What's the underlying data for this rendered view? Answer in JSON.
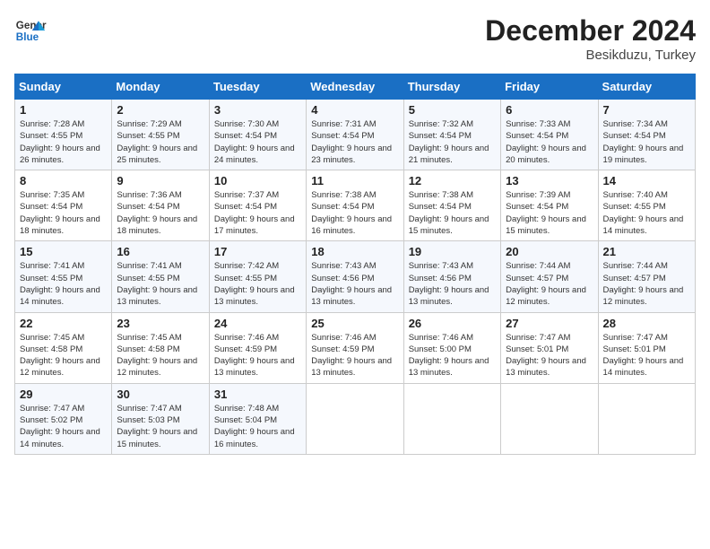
{
  "header": {
    "logo_line1": "General",
    "logo_line2": "Blue",
    "month_year": "December 2024",
    "location": "Besikduzu, Turkey"
  },
  "weekdays": [
    "Sunday",
    "Monday",
    "Tuesday",
    "Wednesday",
    "Thursday",
    "Friday",
    "Saturday"
  ],
  "weeks": [
    [
      {
        "day": "1",
        "sunrise": "7:28 AM",
        "sunset": "4:55 PM",
        "daylight": "9 hours and 26 minutes."
      },
      {
        "day": "2",
        "sunrise": "7:29 AM",
        "sunset": "4:55 PM",
        "daylight": "9 hours and 25 minutes."
      },
      {
        "day": "3",
        "sunrise": "7:30 AM",
        "sunset": "4:54 PM",
        "daylight": "9 hours and 24 minutes."
      },
      {
        "day": "4",
        "sunrise": "7:31 AM",
        "sunset": "4:54 PM",
        "daylight": "9 hours and 23 minutes."
      },
      {
        "day": "5",
        "sunrise": "7:32 AM",
        "sunset": "4:54 PM",
        "daylight": "9 hours and 21 minutes."
      },
      {
        "day": "6",
        "sunrise": "7:33 AM",
        "sunset": "4:54 PM",
        "daylight": "9 hours and 20 minutes."
      },
      {
        "day": "7",
        "sunrise": "7:34 AM",
        "sunset": "4:54 PM",
        "daylight": "9 hours and 19 minutes."
      }
    ],
    [
      {
        "day": "8",
        "sunrise": "7:35 AM",
        "sunset": "4:54 PM",
        "daylight": "9 hours and 18 minutes."
      },
      {
        "day": "9",
        "sunrise": "7:36 AM",
        "sunset": "4:54 PM",
        "daylight": "9 hours and 18 minutes."
      },
      {
        "day": "10",
        "sunrise": "7:37 AM",
        "sunset": "4:54 PM",
        "daylight": "9 hours and 17 minutes."
      },
      {
        "day": "11",
        "sunrise": "7:38 AM",
        "sunset": "4:54 PM",
        "daylight": "9 hours and 16 minutes."
      },
      {
        "day": "12",
        "sunrise": "7:38 AM",
        "sunset": "4:54 PM",
        "daylight": "9 hours and 15 minutes."
      },
      {
        "day": "13",
        "sunrise": "7:39 AM",
        "sunset": "4:54 PM",
        "daylight": "9 hours and 15 minutes."
      },
      {
        "day": "14",
        "sunrise": "7:40 AM",
        "sunset": "4:55 PM",
        "daylight": "9 hours and 14 minutes."
      }
    ],
    [
      {
        "day": "15",
        "sunrise": "7:41 AM",
        "sunset": "4:55 PM",
        "daylight": "9 hours and 14 minutes."
      },
      {
        "day": "16",
        "sunrise": "7:41 AM",
        "sunset": "4:55 PM",
        "daylight": "9 hours and 13 minutes."
      },
      {
        "day": "17",
        "sunrise": "7:42 AM",
        "sunset": "4:55 PM",
        "daylight": "9 hours and 13 minutes."
      },
      {
        "day": "18",
        "sunrise": "7:43 AM",
        "sunset": "4:56 PM",
        "daylight": "9 hours and 13 minutes."
      },
      {
        "day": "19",
        "sunrise": "7:43 AM",
        "sunset": "4:56 PM",
        "daylight": "9 hours and 13 minutes."
      },
      {
        "day": "20",
        "sunrise": "7:44 AM",
        "sunset": "4:57 PM",
        "daylight": "9 hours and 12 minutes."
      },
      {
        "day": "21",
        "sunrise": "7:44 AM",
        "sunset": "4:57 PM",
        "daylight": "9 hours and 12 minutes."
      }
    ],
    [
      {
        "day": "22",
        "sunrise": "7:45 AM",
        "sunset": "4:58 PM",
        "daylight": "9 hours and 12 minutes."
      },
      {
        "day": "23",
        "sunrise": "7:45 AM",
        "sunset": "4:58 PM",
        "daylight": "9 hours and 12 minutes."
      },
      {
        "day": "24",
        "sunrise": "7:46 AM",
        "sunset": "4:59 PM",
        "daylight": "9 hours and 13 minutes."
      },
      {
        "day": "25",
        "sunrise": "7:46 AM",
        "sunset": "4:59 PM",
        "daylight": "9 hours and 13 minutes."
      },
      {
        "day": "26",
        "sunrise": "7:46 AM",
        "sunset": "5:00 PM",
        "daylight": "9 hours and 13 minutes."
      },
      {
        "day": "27",
        "sunrise": "7:47 AM",
        "sunset": "5:01 PM",
        "daylight": "9 hours and 13 minutes."
      },
      {
        "day": "28",
        "sunrise": "7:47 AM",
        "sunset": "5:01 PM",
        "daylight": "9 hours and 14 minutes."
      }
    ],
    [
      {
        "day": "29",
        "sunrise": "7:47 AM",
        "sunset": "5:02 PM",
        "daylight": "9 hours and 14 minutes."
      },
      {
        "day": "30",
        "sunrise": "7:47 AM",
        "sunset": "5:03 PM",
        "daylight": "9 hours and 15 minutes."
      },
      {
        "day": "31",
        "sunrise": "7:48 AM",
        "sunset": "5:04 PM",
        "daylight": "9 hours and 16 minutes."
      },
      null,
      null,
      null,
      null
    ]
  ]
}
